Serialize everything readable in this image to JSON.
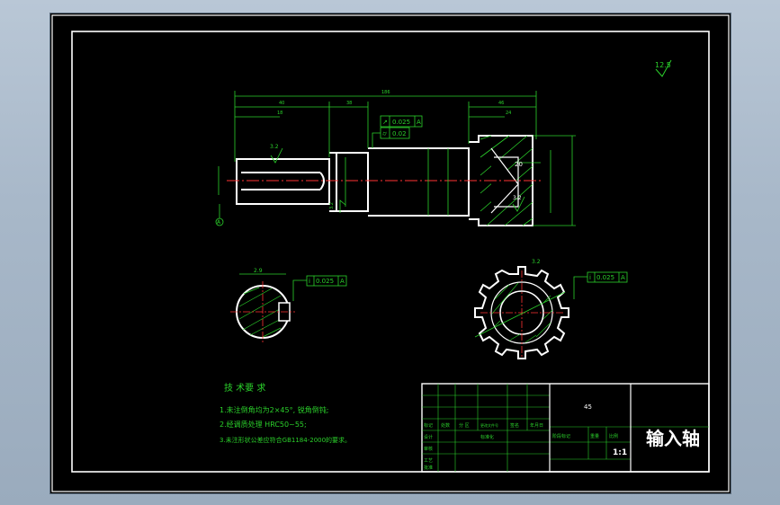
{
  "drawing": {
    "title": "输入轴",
    "roughness_corner": "12.5",
    "dims": {
      "overall": "186",
      "left_seg": "40",
      "left_sub": "18",
      "mid_seg": "38",
      "right_seg": "46",
      "right_sub": "24",
      "bore_depth": "20",
      "rough_left": "3.2",
      "rough_right": "3.2",
      "rough_mid": "3.2",
      "datum": "A",
      "angle_a": "2.9",
      "angle_b": "3.2"
    },
    "tolerances": {
      "runout_sym": "↗",
      "runout_val": "0.025",
      "runout_ref": "A",
      "cyl_sym": "⌭",
      "cyl_val": "0.02",
      "section1_sym": "i",
      "section1_val": "0.025",
      "section1_ref": "A",
      "section2_sym": "i",
      "section2_val": "0.025",
      "section2_ref": "A"
    },
    "notes": {
      "heading": "技 术要 求",
      "line1": "1.未注倒角均为2×45°, 锐角倒钝;",
      "line2": "2.经调质处理 HRC50~55;",
      "line3": "3.未注形状公差应符合GB1184-2000的要求。"
    },
    "title_block": {
      "material_cell": "45",
      "scale": "1:1",
      "labels": [
        "标记",
        "处数",
        "分 区",
        "更改文件号",
        "签名",
        "年月日",
        "设计",
        "标准化",
        "审核",
        "工艺",
        "批准",
        "阶段标记",
        "重量",
        "比例"
      ]
    }
  }
}
